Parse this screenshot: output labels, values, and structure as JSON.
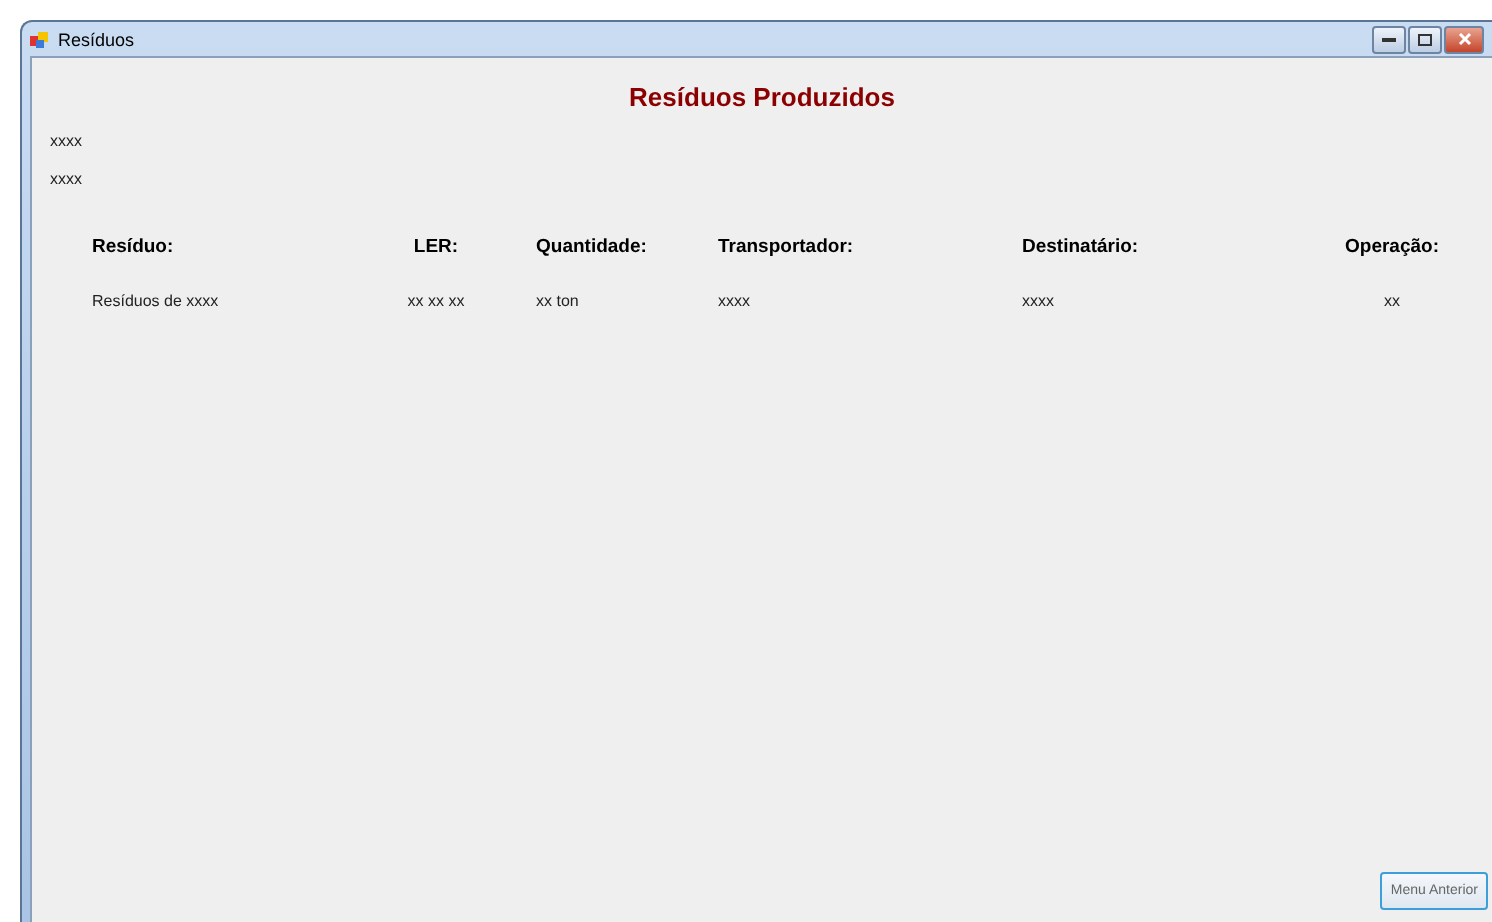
{
  "window": {
    "title": "Resíduos"
  },
  "heading": "Resíduos Produzidos",
  "info_lines": [
    "xxxx",
    "xxxx"
  ],
  "table": {
    "columns": [
      "Resíduo:",
      "LER:",
      "Quantidade:",
      "Transportador:",
      "Destinatário:",
      "Operação:"
    ],
    "rows": [
      [
        "Resíduos de xxxx",
        "xx xx xx",
        "xx ton",
        "xxxx",
        "xxxx",
        "xx"
      ]
    ]
  },
  "buttons": [
    "Menu Anterior"
  ]
}
